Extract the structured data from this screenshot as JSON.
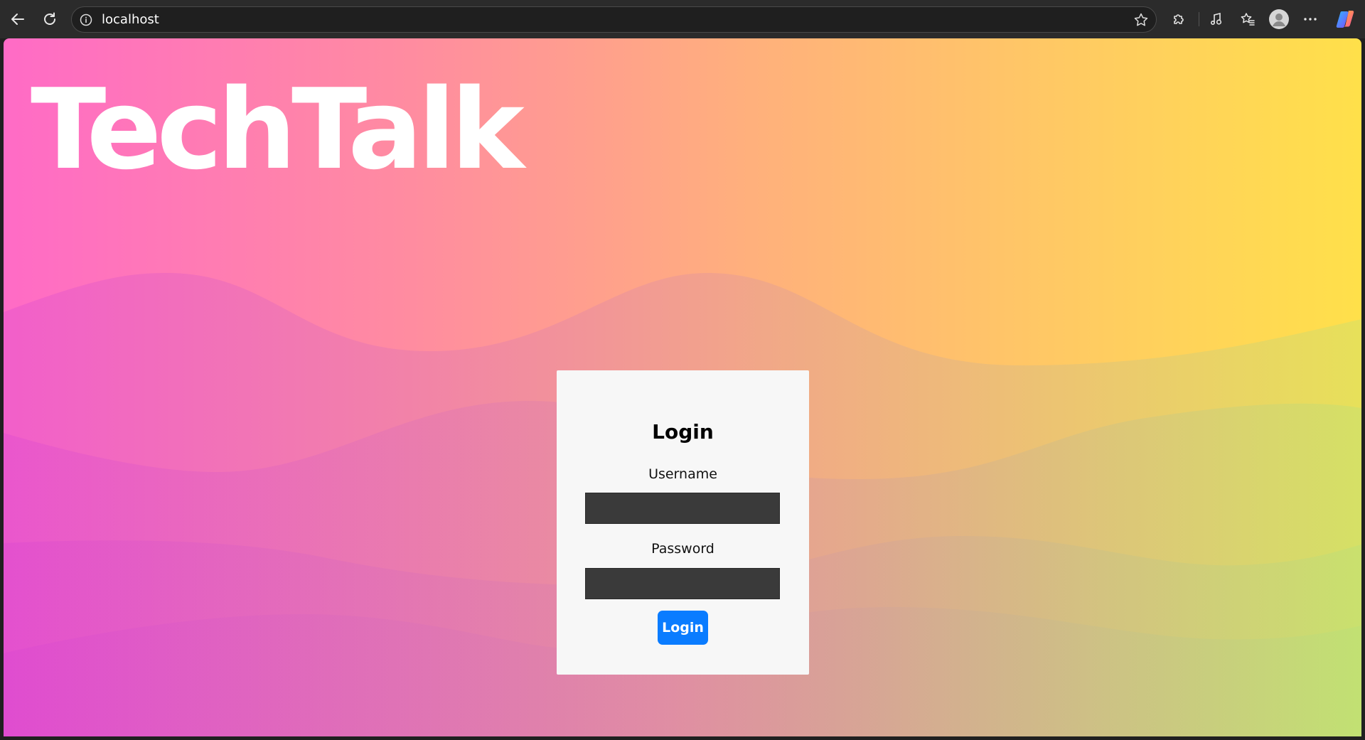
{
  "browser": {
    "url": "localhost"
  },
  "page": {
    "site_title": "TechTalk",
    "background_colors": [
      "#ff6bc6",
      "#ff8ca0",
      "#ffb07c",
      "#ffd15c",
      "#ffe04a"
    ]
  },
  "login_form": {
    "heading": "Login",
    "username_label": "Username",
    "username_value": "",
    "password_label": "Password",
    "password_value": "",
    "submit_label": "Login",
    "submit_color": "#0a7cff"
  },
  "icons": {
    "back": "back-arrow-icon",
    "reload": "reload-icon",
    "info": "info-icon",
    "favorite": "star-icon",
    "extensions": "puzzle-icon",
    "media": "music-note-icon",
    "favorites": "favorites-star-icon",
    "profile": "profile-avatar-icon",
    "menu": "more-dots-icon",
    "copilot": "copilot-icon"
  }
}
